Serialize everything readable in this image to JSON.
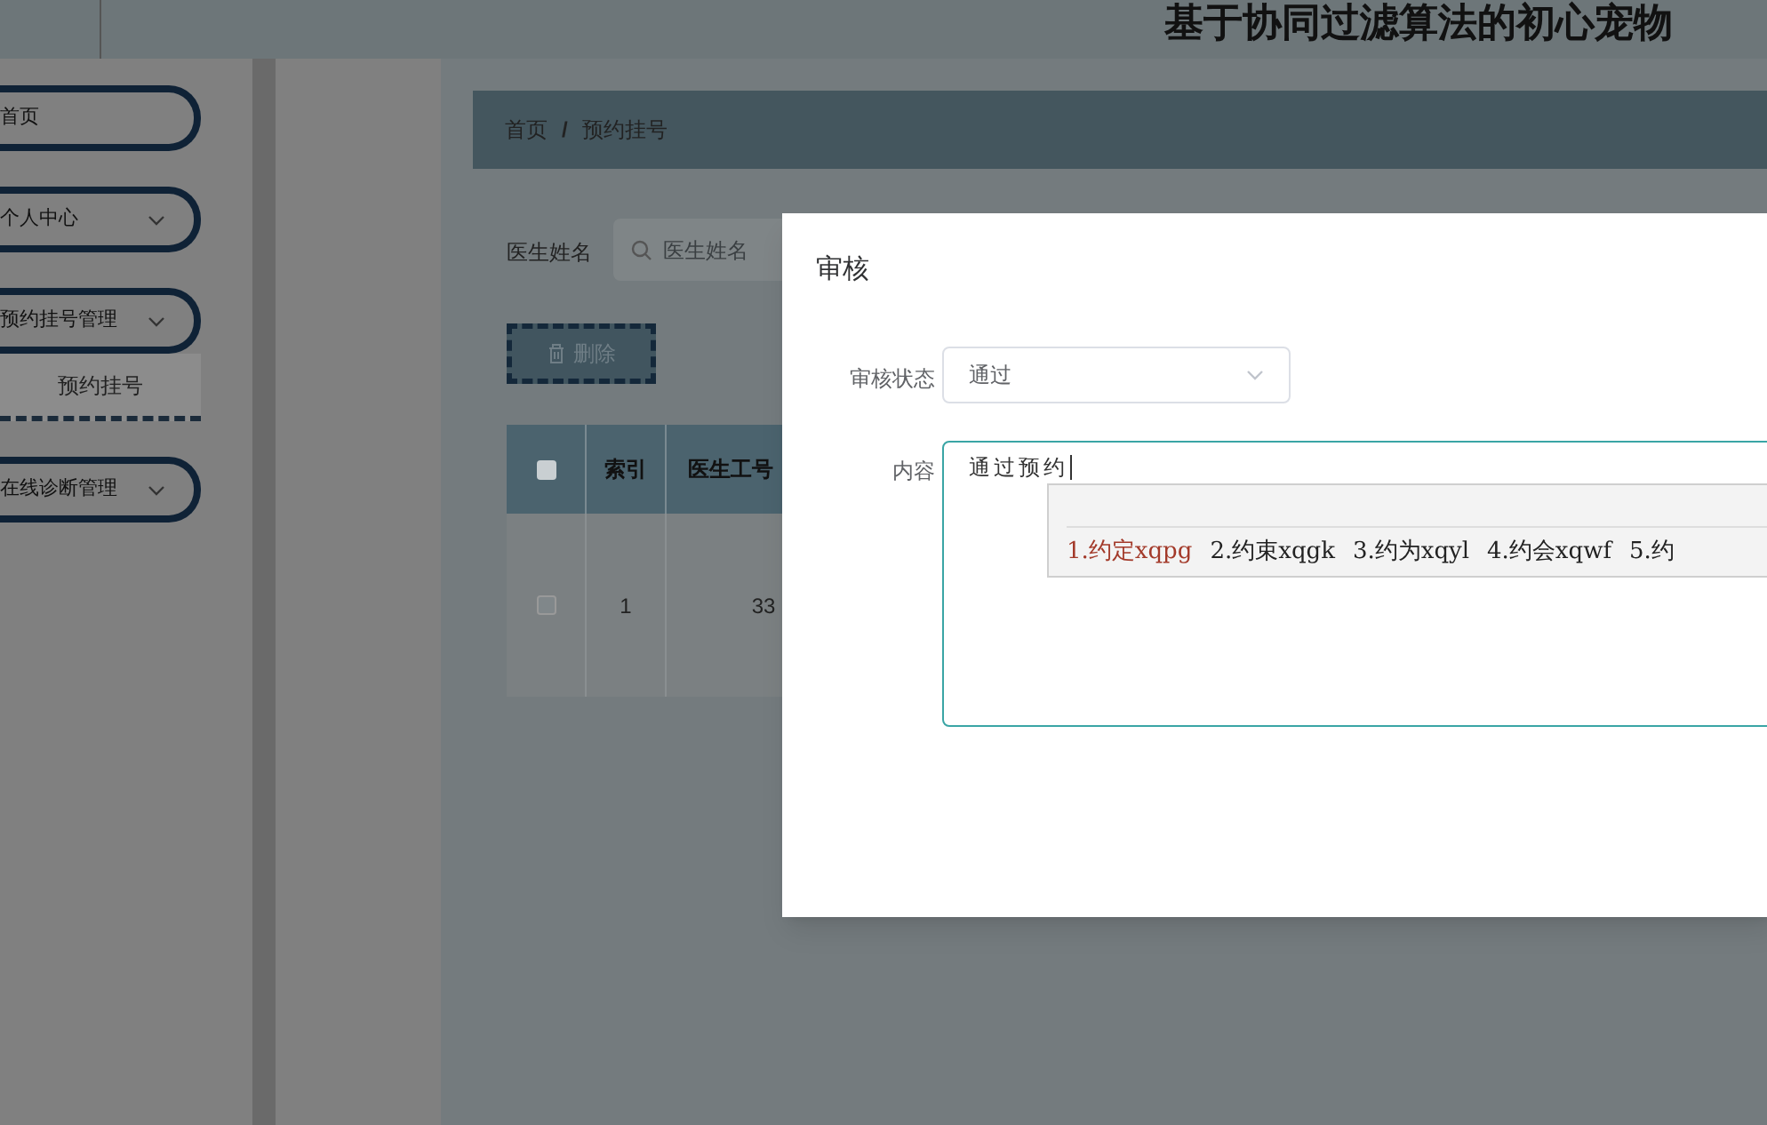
{
  "header": {
    "title": "基于协同过滤算法的初心宠物"
  },
  "sidebar": {
    "items": [
      {
        "label": "首页",
        "expandable": false
      },
      {
        "label": "个人中心",
        "expandable": true
      },
      {
        "label": "预约挂号管理",
        "expandable": true,
        "children": [
          {
            "label": "预约挂号",
            "selected": true
          }
        ]
      },
      {
        "label": "在线诊断管理",
        "expandable": true
      }
    ]
  },
  "breadcrumb": [
    "首页",
    "/",
    "预约挂号"
  ],
  "search": {
    "label": "医生姓名",
    "placeholder": "医生姓名"
  },
  "delete_button": "删除",
  "table": {
    "all_checked": false,
    "columns": [
      "索引",
      "医生工号"
    ],
    "rows": [
      {
        "checked": false,
        "cells": [
          "1",
          "33"
        ]
      }
    ]
  },
  "dialog": {
    "title": "审核",
    "fields": [
      {
        "kind": "select",
        "label": "审核状态",
        "value": "通过"
      },
      {
        "kind": "textarea",
        "label": "内容",
        "value": "通过预约"
      }
    ]
  },
  "ime": {
    "candidates": [
      {
        "text": "1.约定xqpg",
        "selected": true
      },
      {
        "text": "2.约束xqgk",
        "selected": false
      },
      {
        "text": "3.约为xqyl",
        "selected": false
      },
      {
        "text": "4.约会xqwf",
        "selected": false
      },
      {
        "text": "5.约",
        "selected": false
      }
    ]
  }
}
